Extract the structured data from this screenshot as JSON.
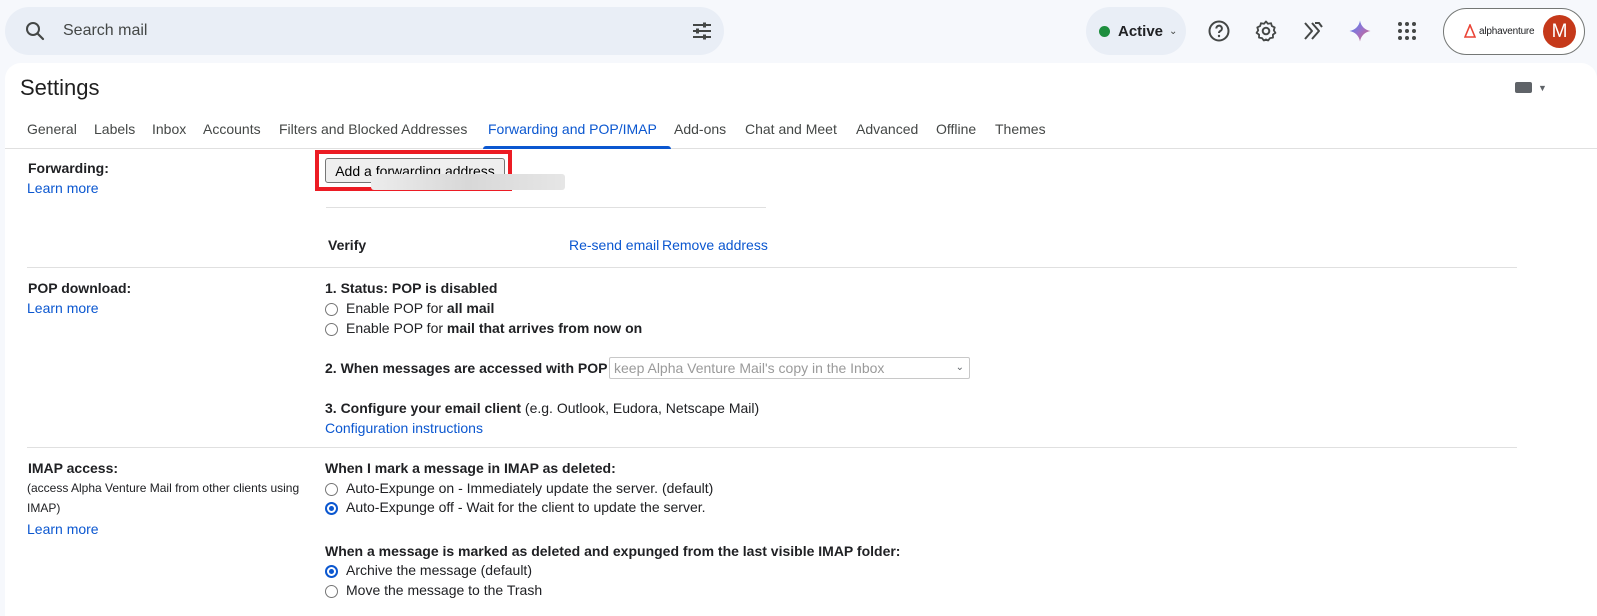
{
  "search": {
    "placeholder": "Search mail"
  },
  "status": {
    "label": "Active",
    "color": "#1e8e3e"
  },
  "account": {
    "brand": "alphaventure",
    "avatar_letter": "M",
    "avatar_color": "#c5391a"
  },
  "icons": [
    "search-icon",
    "filter-icon",
    "help-icon",
    "gear-icon",
    "apps-script-icon",
    "gemini-icon",
    "apps-grid-icon",
    "keyboard-icon"
  ],
  "page": {
    "title": "Settings"
  },
  "tabs": [
    {
      "label": "General"
    },
    {
      "label": "Labels"
    },
    {
      "label": "Inbox"
    },
    {
      "label": "Accounts"
    },
    {
      "label": "Filters and Blocked Addresses"
    },
    {
      "label": "Forwarding and POP/IMAP",
      "active": true
    },
    {
      "label": "Add-ons"
    },
    {
      "label": "Chat and Meet"
    },
    {
      "label": "Advanced"
    },
    {
      "label": "Offline"
    },
    {
      "label": "Themes"
    }
  ],
  "forwarding": {
    "label": "Forwarding:",
    "learn_more": "Learn more",
    "add_button": "Add a forwarding address",
    "verify_prefix": "Verify",
    "resend": "Re-send email",
    "remove": "Remove address"
  },
  "pop": {
    "label": "POP download:",
    "learn_more": "Learn more",
    "status": "1. Status: POP is disabled",
    "opt_all_prefix": "Enable POP for ",
    "opt_all_bold": "all mail",
    "opt_now_prefix": "Enable POP for ",
    "opt_now_bold": "mail that arrives from now on",
    "when_accessed": "2. When messages are accessed with POP",
    "select_value": "keep Alpha Venture Mail's copy in the Inbox",
    "configure_bold": "3. Configure your email client",
    "configure_rest": " (e.g. Outlook, Eudora, Netscape Mail)",
    "config_link": "Configuration instructions"
  },
  "imap": {
    "label": "IMAP access:",
    "desc": "(access Alpha Venture Mail from other clients using IMAP)",
    "learn_more": "Learn more",
    "deleted_heading": "When I mark a message in IMAP as deleted:",
    "expunge_on": "Auto-Expunge on - Immediately update the server. (default)",
    "expunge_off": "Auto-Expunge off - Wait for the client to update the server.",
    "expunged_heading": "When a message is marked as deleted and expunged from the last visible IMAP folder:",
    "archive": "Archive the message (default)",
    "trash": "Move the message to the Trash"
  }
}
